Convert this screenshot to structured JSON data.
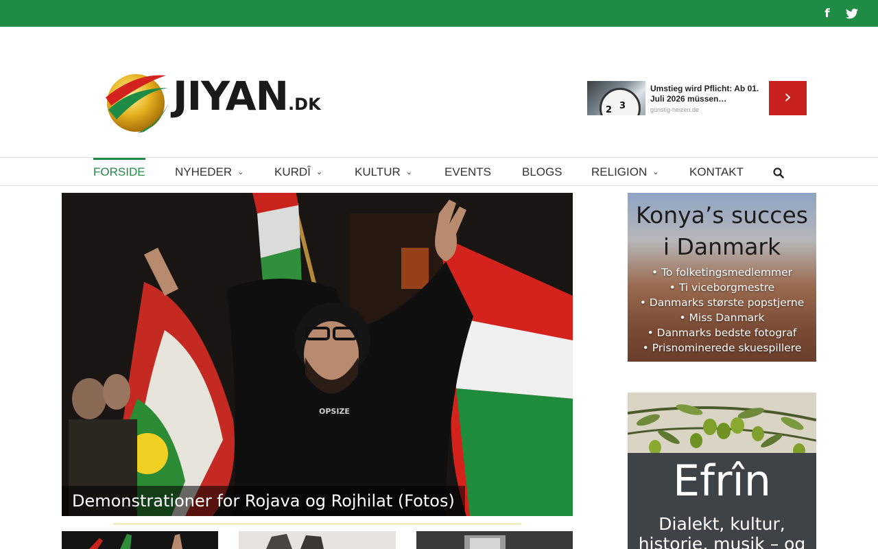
{
  "topbar": {
    "social_icons": [
      "facebook-icon",
      "twitter-icon"
    ],
    "facebook_glyph": "f",
    "twitter_glyph": "t",
    "accent_color": "#1f8c46"
  },
  "header": {
    "logo_text": "JIYAN",
    "logo_suffix": ".DK"
  },
  "ad": {
    "title": "Umstieg wird Pflicht: Ab 01. Juli 2026 müssen…",
    "source": "günstig-heizen.de",
    "button_icon": "chevron-right-icon",
    "button_glyph": "›",
    "dial_numbers": [
      "2",
      "3"
    ]
  },
  "nav": {
    "items": [
      {
        "label": "FORSIDE",
        "active": true,
        "dropdown": false
      },
      {
        "label": "NYHEDER",
        "active": false,
        "dropdown": true
      },
      {
        "label": "KURDÎ",
        "active": false,
        "dropdown": true
      },
      {
        "label": "KULTUR",
        "active": false,
        "dropdown": true
      },
      {
        "label": "EVENTS",
        "active": false,
        "dropdown": false
      },
      {
        "label": "BLOGS",
        "active": false,
        "dropdown": false
      },
      {
        "label": "RELIGION",
        "active": false,
        "dropdown": true
      },
      {
        "label": "KONTAKT",
        "active": false,
        "dropdown": false
      }
    ],
    "dropdown_glyph": "⌄",
    "search_icon": "search-icon"
  },
  "hero": {
    "caption": "Demonstrationer for Rojava og Rojhilat (Fotos)",
    "shirt_text": "OPSIZE"
  },
  "sidebar": {
    "konya": {
      "title_line1": "Konya’s succes",
      "title_line2": "i Danmark",
      "bullets": [
        "• To folketingsmedlemmer",
        "• Ti viceborgmestre",
        "• Danmarks største popstjerne",
        "• Miss Danmark",
        "• Danmarks bedste fotograf",
        "• Prisnominerede skuespillere"
      ]
    },
    "efrin": {
      "title": "Efrîn",
      "subtitle_line1": "Dialekt, kultur,",
      "subtitle_line2": "historie, musik – og"
    }
  }
}
